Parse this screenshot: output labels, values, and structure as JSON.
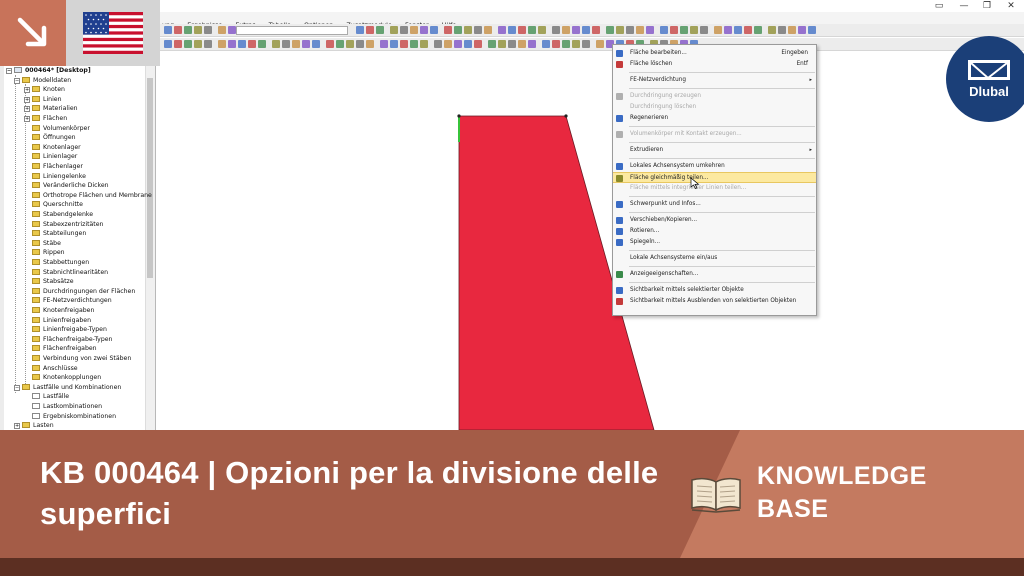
{
  "window": {
    "controls": [
      "▭",
      "—",
      "❐",
      "✕"
    ]
  },
  "menubar": {
    "items": [
      "ung",
      "Ergebnisse",
      "Extras",
      "Tabelle",
      "Optionen",
      "Zusatzmodule",
      "Fenster",
      "Hilfe"
    ]
  },
  "navigator": {
    "root": "000464* [Desktop]",
    "items": [
      {
        "label": "Modelldaten",
        "level": 1,
        "type": "folder",
        "expander": "−"
      },
      {
        "label": "Knoten",
        "level": 2,
        "type": "folder",
        "expander": "+"
      },
      {
        "label": "Linien",
        "level": 2,
        "type": "folder",
        "expander": "+"
      },
      {
        "label": "Materialien",
        "level": 2,
        "type": "folder",
        "expander": "+"
      },
      {
        "label": "Flächen",
        "level": 2,
        "type": "folder",
        "expander": "+"
      },
      {
        "label": "Volumenkörper",
        "level": 2,
        "type": "folder",
        "expander": ""
      },
      {
        "label": "Öffnungen",
        "level": 2,
        "type": "folder",
        "expander": ""
      },
      {
        "label": "Knotenlager",
        "level": 2,
        "type": "folder",
        "expander": ""
      },
      {
        "label": "Linienlager",
        "level": 2,
        "type": "folder",
        "expander": ""
      },
      {
        "label": "Flächenlager",
        "level": 2,
        "type": "folder",
        "expander": ""
      },
      {
        "label": "Liniengelenke",
        "level": 2,
        "type": "folder",
        "expander": ""
      },
      {
        "label": "Veränderliche Dicken",
        "level": 2,
        "type": "folder",
        "expander": ""
      },
      {
        "label": "Orthotrope Flächen und Membrane",
        "level": 2,
        "type": "folder",
        "expander": ""
      },
      {
        "label": "Querschnitte",
        "level": 2,
        "type": "folder",
        "expander": ""
      },
      {
        "label": "Stabendgelenke",
        "level": 2,
        "type": "folder",
        "expander": ""
      },
      {
        "label": "Stabexzentrizitäten",
        "level": 2,
        "type": "folder",
        "expander": ""
      },
      {
        "label": "Stabteilungen",
        "level": 2,
        "type": "folder",
        "expander": ""
      },
      {
        "label": "Stäbe",
        "level": 2,
        "type": "folder",
        "expander": ""
      },
      {
        "label": "Rippen",
        "level": 2,
        "type": "folder",
        "expander": ""
      },
      {
        "label": "Stabbettungen",
        "level": 2,
        "type": "folder",
        "expander": ""
      },
      {
        "label": "Stabnichtlinearitäten",
        "level": 2,
        "type": "folder",
        "expander": ""
      },
      {
        "label": "Stabsätze",
        "level": 2,
        "type": "folder",
        "expander": ""
      },
      {
        "label": "Durchdringungen der Flächen",
        "level": 2,
        "type": "folder",
        "expander": ""
      },
      {
        "label": "FE-Netzverdichtungen",
        "level": 2,
        "type": "folder",
        "expander": ""
      },
      {
        "label": "Knotenfreigaben",
        "level": 2,
        "type": "folder",
        "expander": ""
      },
      {
        "label": "Linienfreigaben",
        "level": 2,
        "type": "folder",
        "expander": ""
      },
      {
        "label": "Linienfreigabe-Typen",
        "level": 2,
        "type": "folder",
        "expander": ""
      },
      {
        "label": "Flächenfreigabe-Typen",
        "level": 2,
        "type": "folder",
        "expander": ""
      },
      {
        "label": "Flächenfreigaben",
        "level": 2,
        "type": "folder",
        "expander": ""
      },
      {
        "label": "Verbindung von zwei Stäben",
        "level": 2,
        "type": "folder",
        "expander": ""
      },
      {
        "label": "Anschlüsse",
        "level": 2,
        "type": "folder",
        "expander": ""
      },
      {
        "label": "Knotenkopplungen",
        "level": 2,
        "type": "folder",
        "expander": ""
      },
      {
        "label": "Lastfälle und Kombinationen",
        "level": 1,
        "type": "folder",
        "expander": "−"
      },
      {
        "label": "Lastfälle",
        "level": 2,
        "type": "leaf",
        "expander": ""
      },
      {
        "label": "Lastkombinationen",
        "level": 2,
        "type": "leaf",
        "expander": ""
      },
      {
        "label": "Ergebniskombinationen",
        "level": 2,
        "type": "leaf",
        "expander": ""
      },
      {
        "label": "Lasten",
        "level": 1,
        "type": "folder",
        "expander": "+"
      }
    ]
  },
  "context_menu": {
    "items": [
      {
        "label": "Fläche bearbeiten...",
        "shortcut": "Eingeben",
        "disabled": false,
        "icon": "edit-surface-icon",
        "color": "#3a6bc4"
      },
      {
        "label": "Fläche löschen",
        "shortcut": "Entf",
        "disabled": false,
        "icon": "delete-surface-icon",
        "color": "#c43a3a"
      },
      {
        "sep": true
      },
      {
        "label": "FE-Netzverdichtung",
        "shortcut": "",
        "submenu": true,
        "disabled": false,
        "icon": "",
        "color": ""
      },
      {
        "sep": true
      },
      {
        "label": "Durchdringung erzeugen",
        "shortcut": "",
        "disabled": true,
        "icon": "intersection-icon",
        "color": "#b0b0b0"
      },
      {
        "label": "Durchdringung löschen",
        "shortcut": "",
        "disabled": true,
        "icon": "",
        "color": ""
      },
      {
        "label": "Regenerieren",
        "shortcut": "",
        "disabled": false,
        "icon": "regenerate-icon",
        "color": "#3a6bc4"
      },
      {
        "sep": true
      },
      {
        "label": "Volumenkörper mit Kontakt erzeugen...",
        "shortcut": "",
        "disabled": true,
        "icon": "solid-icon",
        "color": "#b0b0b0"
      },
      {
        "sep": true
      },
      {
        "label": "Extrudieren",
        "shortcut": "",
        "submenu": true,
        "disabled": false,
        "icon": "",
        "color": ""
      },
      {
        "sep": true
      },
      {
        "label": "Lokales Achsensystem umkehren",
        "shortcut": "",
        "disabled": false,
        "icon": "axis-reverse-icon",
        "color": "#3a6bc4"
      },
      {
        "label": "Fläche gleichmäßig teilen...",
        "shortcut": "",
        "disabled": false,
        "highlight": true,
        "icon": "divide-surface-icon",
        "color": "#8a8a2a"
      },
      {
        "label": "Fläche mittels integrierter Linien teilen...",
        "shortcut": "",
        "disabled": true,
        "icon": "",
        "color": ""
      },
      {
        "sep": true
      },
      {
        "label": "Schwerpunkt und Infos...",
        "shortcut": "",
        "disabled": false,
        "icon": "centroid-icon",
        "color": "#3a6bc4"
      },
      {
        "sep": true
      },
      {
        "label": "Verschieben/Kopieren...",
        "shortcut": "",
        "disabled": false,
        "icon": "move-copy-icon",
        "color": "#3a6bc4"
      },
      {
        "label": "Rotieren...",
        "shortcut": "",
        "disabled": false,
        "icon": "rotate-icon",
        "color": "#3a6bc4"
      },
      {
        "label": "Spiegeln...",
        "shortcut": "",
        "disabled": false,
        "icon": "mirror-icon",
        "color": "#3a6bc4"
      },
      {
        "sep": true
      },
      {
        "label": "Lokale Achsensysteme ein/aus",
        "shortcut": "",
        "disabled": false,
        "icon": "",
        "color": ""
      },
      {
        "sep": true
      },
      {
        "label": "Anzeigeeigenschaften...",
        "shortcut": "",
        "disabled": false,
        "icon": "display-properties-icon",
        "color": "#3a8a4a"
      },
      {
        "sep": true
      },
      {
        "label": "Sichtbarkeit mittels selektierter Objekte",
        "shortcut": "",
        "disabled": false,
        "icon": "visibility-selected-icon",
        "color": "#3a6bc4"
      },
      {
        "label": "Sichtbarkeit mittels Ausblenden von selektierten Objekten",
        "shortcut": "",
        "disabled": false,
        "icon": "visibility-hide-icon",
        "color": "#c43a3a"
      }
    ]
  },
  "brand": {
    "name": "Dlubal"
  },
  "banner": {
    "title": "KB 000464 | Opzioni per la divisione delle superfici",
    "label": "KNOWLEDGE BASE"
  },
  "colors": {
    "surface": "#e8283f",
    "banner_dark": "#a45c47",
    "banner_light": "#c47a60",
    "footer": "#5c2f22",
    "dlubal_blue": "#1b3f78"
  }
}
